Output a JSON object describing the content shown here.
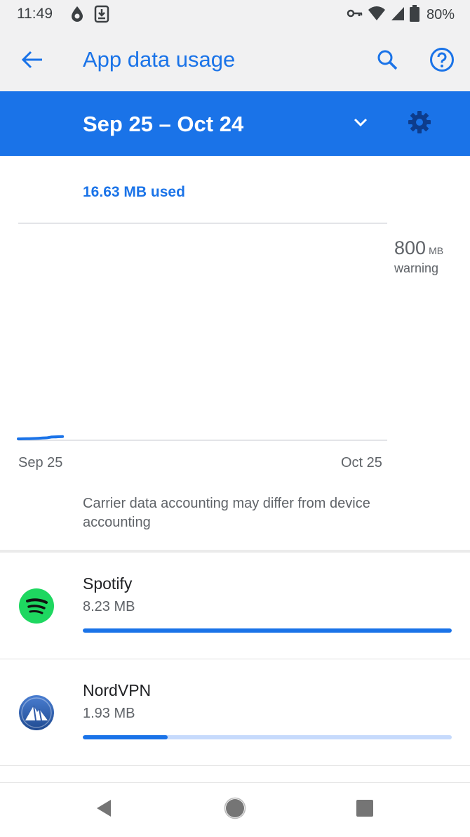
{
  "status_bar": {
    "time": "11:49",
    "battery": "80%",
    "left_icons": [
      "drop-icon",
      "download-icon"
    ],
    "right_icons": [
      "vpn-key-icon",
      "wifi-icon",
      "signal-icon",
      "battery-icon"
    ]
  },
  "app_bar": {
    "title": "App data usage",
    "icons": [
      "back-arrow-icon",
      "search-icon",
      "help-icon"
    ]
  },
  "period": {
    "label": "Sep 25 – Oct 24",
    "icons": [
      "chevron-down-icon",
      "gear-icon"
    ]
  },
  "usage": {
    "total": "16.63 MB used"
  },
  "chart": {
    "warning_value": "800",
    "warning_unit": "MB",
    "warning_label": "warning",
    "x_start": "Sep 25",
    "x_end": "Oct 25"
  },
  "chart_data": {
    "type": "line",
    "title": "",
    "xlabel": "",
    "ylabel": "",
    "x_range": [
      "Sep 25",
      "Oct 25"
    ],
    "ylim": [
      0,
      800
    ],
    "warning_mb": 800,
    "series": [
      {
        "x": [
          "Sep 25",
          "Sep 26",
          "Sep 27",
          "Sep 28",
          "Sep 29",
          "Sep 30"
        ],
        "values": [
          0,
          1,
          3,
          7,
          14,
          16.63
        ]
      }
    ],
    "grid": false,
    "color": "#1a73e8"
  },
  "note": {
    "text": "Carrier data accounting may differ from device accounting"
  },
  "apps": [
    {
      "name": "Spotify",
      "size": "8.23 MB",
      "fraction": 1.0,
      "icon": "spotify-icon"
    },
    {
      "name": "NordVPN",
      "size": "1.93 MB",
      "fraction": 0.23,
      "icon": "nordvpn-icon"
    }
  ],
  "colors": {
    "accent": "#1a73e8",
    "accent_light": "#c6dafc",
    "spotify": "#1ed760",
    "nordvpn": "#2f5aa8"
  },
  "nav_bar": {
    "icons": [
      "nav-back-icon",
      "nav-home-icon",
      "nav-recents-icon"
    ]
  }
}
